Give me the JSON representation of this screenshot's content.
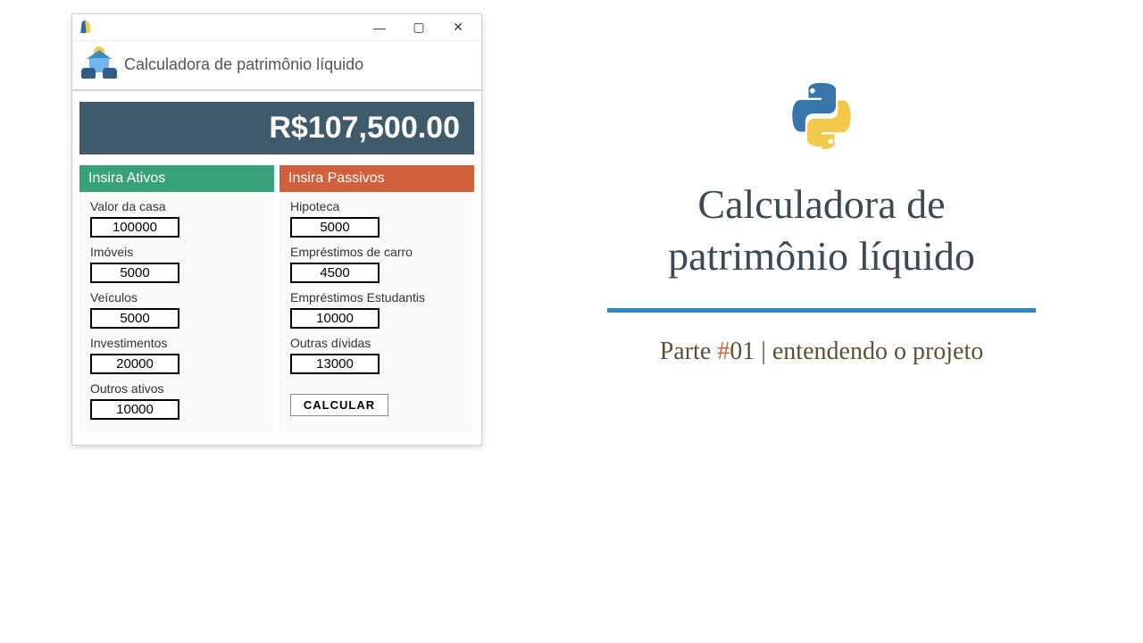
{
  "window": {
    "title": "",
    "app_title": "Calculadora de patrimônio líquido",
    "minimize": "—",
    "maximize": "▢",
    "close": "✕"
  },
  "result": "R$107,500.00",
  "assets": {
    "header": "Insira Ativos",
    "fields": [
      {
        "label": "Valor da casa",
        "value": "100000"
      },
      {
        "label": "Imóveis",
        "value": "5000"
      },
      {
        "label": "Veículos",
        "value": "5000"
      },
      {
        "label": "Investimentos",
        "value": "20000"
      },
      {
        "label": "Outros ativos",
        "value": "10000"
      }
    ]
  },
  "liabilities": {
    "header": "Insira Passivos",
    "fields": [
      {
        "label": "Hipoteca",
        "value": "5000"
      },
      {
        "label": "Empréstimos de carro",
        "value": "4500"
      },
      {
        "label": "Empréstimos Estudantis",
        "value": "10000"
      },
      {
        "label": "Outras dívidas",
        "value": "13000"
      }
    ],
    "button": "CALCULAR"
  },
  "slide": {
    "title_line1": "Calculadora de",
    "title_line2": "patrimônio líquido",
    "sub_prefix": "Parte ",
    "sub_hash": "#",
    "sub_num": "01",
    "sub_sep": " | ",
    "sub_text": "entendendo o projeto"
  }
}
